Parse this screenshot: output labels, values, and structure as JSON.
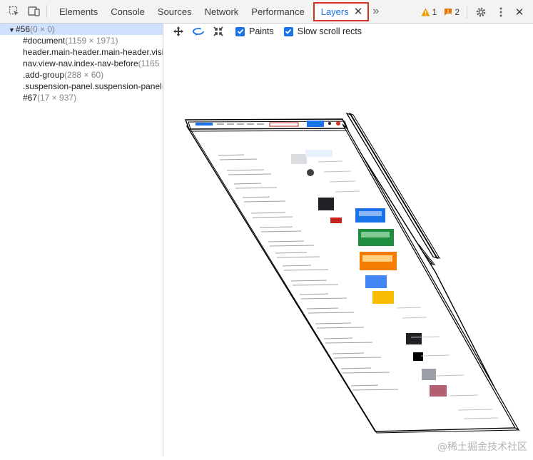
{
  "toolbar": {
    "tabs": [
      {
        "label": "Elements"
      },
      {
        "label": "Console"
      },
      {
        "label": "Sources"
      },
      {
        "label": "Network"
      },
      {
        "label": "Performance"
      },
      {
        "label": "Layers"
      }
    ],
    "active_tab": "Layers",
    "more_tabs_glyph": "»",
    "warnings_count": "1",
    "issues_count": "2",
    "colors": {
      "warning": "#f29900",
      "issue": "#e37400",
      "highlight": "#d93025",
      "accent": "#1a73e8"
    }
  },
  "layer_tree": {
    "root": {
      "name": "#56",
      "size": "(0 × 0)"
    },
    "children": [
      {
        "name": "#document",
        "size": "(1159 × 1971)"
      },
      {
        "name": "header.main-header.main-header.visi",
        "size": ""
      },
      {
        "name": "nav.view-nav.index-nav-before",
        "size": "(1165"
      },
      {
        "name": ".add-group",
        "size": "(288 × 60)"
      },
      {
        "name": ".suspension-panel.suspension-panel",
        "size": "("
      },
      {
        "name": "#67",
        "size": "(17 × 937)"
      }
    ]
  },
  "layers_toolbar": {
    "tools": [
      "pan-mode-icon",
      "rotate-mode-icon",
      "reset-transform-icon"
    ],
    "paints_label": "Paints",
    "paints_checked": true,
    "slow_scroll_label": "Slow scroll rects",
    "slow_scroll_checked": true
  },
  "watermark": "@稀土掘金技术社区"
}
